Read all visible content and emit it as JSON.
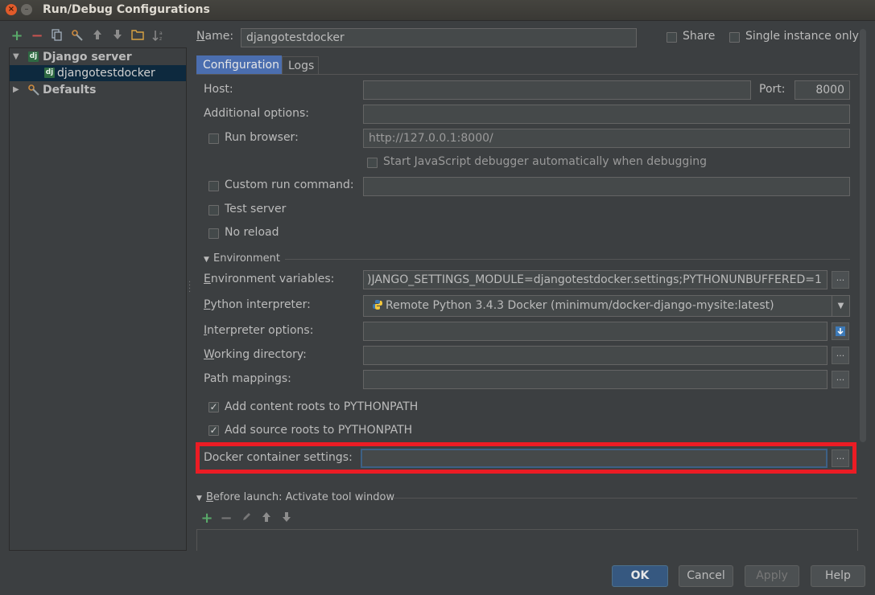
{
  "window": {
    "title": "Run/Debug Configurations",
    "close_glyph": "×",
    "min_glyph": "–"
  },
  "left_toolbar": {
    "icons": [
      "add-icon",
      "remove-icon",
      "copy-icon",
      "edit-defaults-icon",
      "move-up-icon",
      "move-down-icon",
      "folder-icon",
      "sort-icon"
    ]
  },
  "tree": {
    "items": [
      {
        "label": "Django server",
        "badge": "dj",
        "expanded": true
      },
      {
        "label": "djangotestdocker",
        "badge": "dj",
        "selected": true
      },
      {
        "label": "Defaults",
        "expanded": false
      }
    ]
  },
  "header": {
    "name_label": "Name:",
    "name_value": "djangotestdocker",
    "share_label": "Share",
    "single_instance_label": "Single instance only"
  },
  "tabs": [
    {
      "label": "Configuration",
      "active": true
    },
    {
      "label": "Logs",
      "active": false
    }
  ],
  "config": {
    "host_label": "Host:",
    "host_value": "",
    "port_label": "Port:",
    "port_value": "8000",
    "additional_options_label": "Additional options:",
    "additional_options_value": "",
    "run_browser_label": "Run browser:",
    "run_browser_checked": false,
    "run_browser_url": "http://127.0.0.1:8000/",
    "js_debugger_label": "Start JavaScript debugger automatically when debugging",
    "custom_run_label": "Custom run command:",
    "custom_run_value": "",
    "test_server_label": "Test server",
    "no_reload_label": "No reload"
  },
  "environment": {
    "section_label": "Environment",
    "env_vars_label": "Environment variables:",
    "env_vars_value": ")JANGO_SETTINGS_MODULE=djangotestdocker.settings;PYTHONUNBUFFERED=1",
    "interpreter_label": "Python interpreter:",
    "interpreter_value": "Remote Python 3.4.3 Docker (minimum/docker-django-mysite:latest)",
    "interpreter_options_label": "Interpreter options:",
    "interpreter_options_value": "",
    "working_dir_label": "Working directory:",
    "working_dir_value": "",
    "path_mappings_label": "Path mappings:",
    "path_mappings_value": "",
    "add_content_roots_label": "Add content roots to PYTHONPATH",
    "add_content_roots_checked": true,
    "add_source_roots_label": "Add source roots to PYTHONPATH",
    "add_source_roots_checked": true,
    "docker_settings_label": "Docker container settings:",
    "docker_settings_value": ""
  },
  "before_launch": {
    "label": "Before launch: Activate tool window",
    "tool_icons": [
      "add-icon",
      "remove-icon",
      "edit-icon",
      "move-up-icon",
      "move-down-icon"
    ]
  },
  "buttons": {
    "ok": "OK",
    "cancel": "Cancel",
    "apply": "Apply",
    "help": "Help"
  },
  "glyphs": {
    "ellipsis": "...",
    "check": "✓",
    "dropdown": "▼",
    "caret_down": "▼",
    "caret_right": "▶"
  },
  "colors": {
    "accent_red": "#ec1c24",
    "tab_active": "#4b6eaf",
    "selected_row": "#0d293e",
    "add_green": "#59a869",
    "remove_red": "#c75450"
  }
}
